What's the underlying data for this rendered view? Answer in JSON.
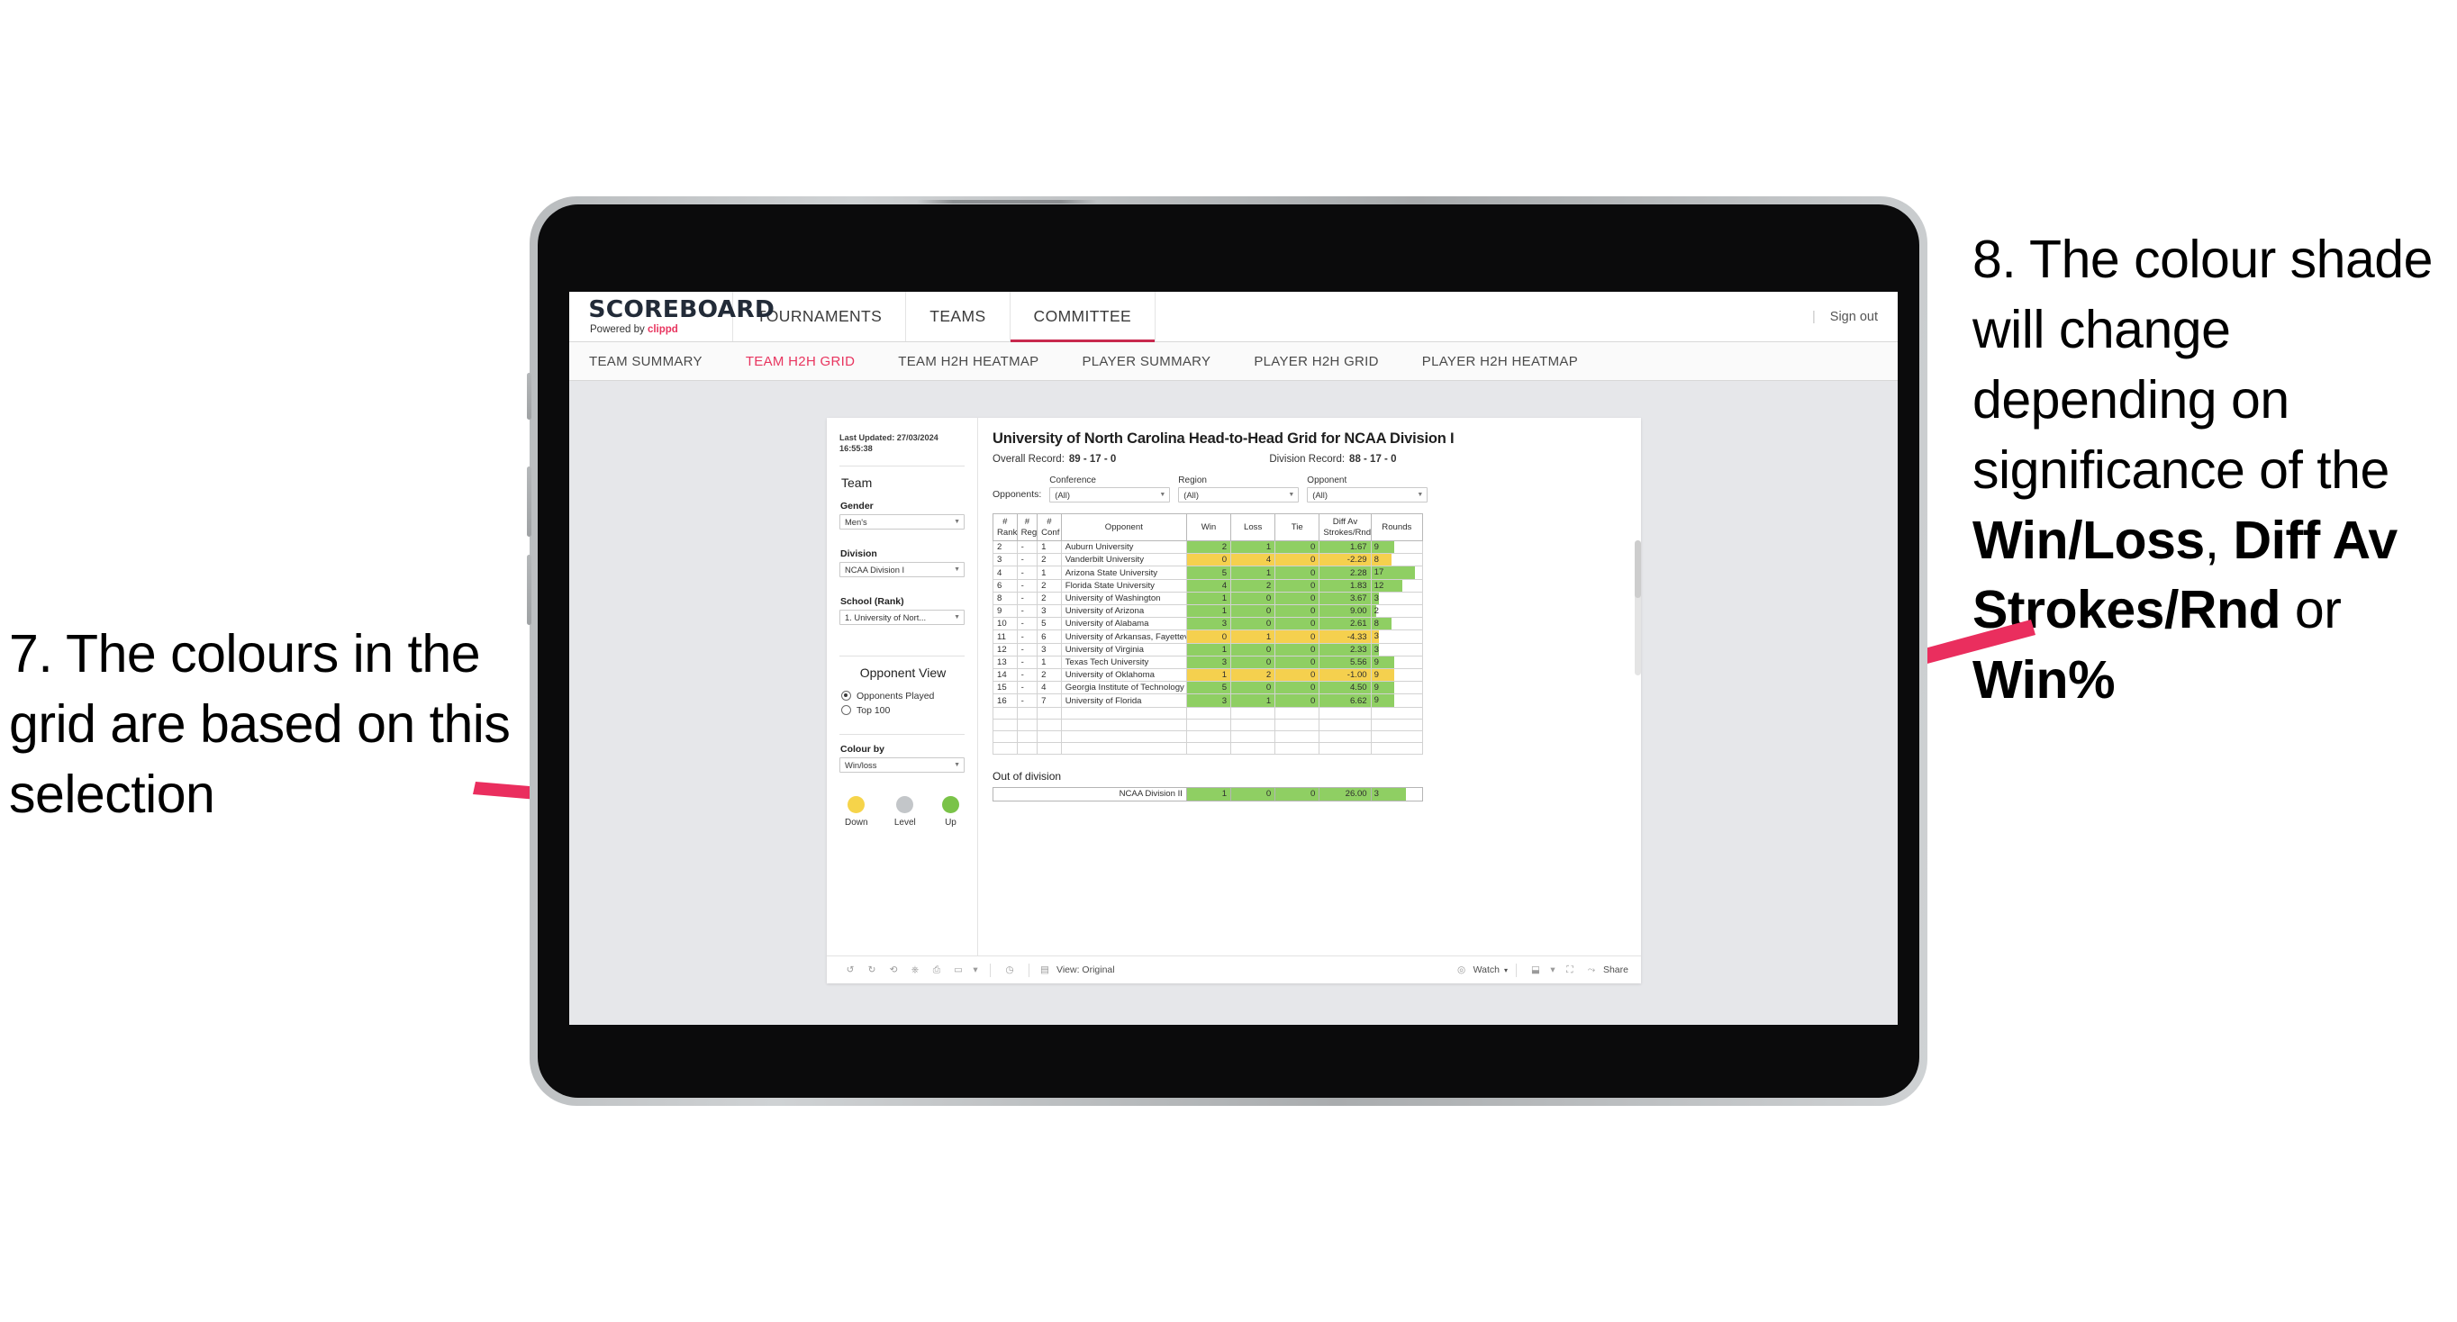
{
  "annotations": {
    "left": {
      "number": "7.",
      "text": "7. The colours in the grid are based on this selection"
    },
    "right": {
      "line1": "8. The colour shade will change depending on significance of the ",
      "bold1": "Win/Loss",
      "mid1": ", ",
      "bold2": "Diff Av Strokes/Rnd",
      "mid2": " or ",
      "bold3": "Win%"
    },
    "arrow_color": "#ea2e5e"
  },
  "app": {
    "brand": {
      "title": "SCOREBOARD",
      "powered_prefix": "Powered by ",
      "powered_brand": "clippd"
    },
    "top_nav": [
      {
        "label": "TOURNAMENTS",
        "active": false
      },
      {
        "label": "TEAMS",
        "active": false
      },
      {
        "label": "COMMITTEE",
        "active": true
      }
    ],
    "sign_out": "Sign out",
    "sign_out_divider": "|",
    "sub_nav": [
      {
        "label": "TEAM SUMMARY",
        "active": false
      },
      {
        "label": "TEAM H2H GRID",
        "active": true
      },
      {
        "label": "TEAM H2H HEATMAP",
        "active": false
      },
      {
        "label": "PLAYER SUMMARY",
        "active": false
      },
      {
        "label": "PLAYER H2H GRID",
        "active": false
      },
      {
        "label": "PLAYER H2H HEATMAP",
        "active": false
      }
    ]
  },
  "sidebar": {
    "last_updated": "Last Updated: 27/03/2024 16:55:38",
    "team_heading": "Team",
    "gender_label": "Gender",
    "gender_value": "Men's",
    "division_label": "Division",
    "division_value": "NCAA Division I",
    "school_label": "School (Rank)",
    "school_value": "1. University of Nort...",
    "opponent_view_heading": "Opponent View",
    "opponent_view_options": [
      {
        "label": "Opponents Played",
        "selected": true
      },
      {
        "label": "Top 100",
        "selected": false
      }
    ],
    "colour_by_label": "Colour by",
    "colour_by_value": "Win/loss",
    "legend": [
      {
        "label": "Down",
        "color": "#f6d44a"
      },
      {
        "label": "Level",
        "color": "#c3c6c9"
      },
      {
        "label": "Up",
        "color": "#7ac348"
      }
    ]
  },
  "viz": {
    "title": "University of North Carolina Head-to-Head Grid for NCAA Division I",
    "overall_record_label": "Overall Record:",
    "overall_record_value": "89 - 17 - 0",
    "division_record_label": "Division Record:",
    "division_record_value": "88 - 17 - 0",
    "opponents_label": "Opponents:",
    "filters": [
      {
        "label": "Conference",
        "value": "(All)"
      },
      {
        "label": "Region",
        "value": "(All)"
      },
      {
        "label": "Opponent",
        "value": "(All)"
      }
    ],
    "columns": [
      "# Rank",
      "# Reg",
      "# Conf",
      "Opponent",
      "Win",
      "Loss",
      "Tie",
      "Diff Av Strokes/Rnd",
      "Rounds"
    ],
    "columns_split": [
      {
        "l1": "#",
        "l2": "Rank"
      },
      {
        "l1": "#",
        "l2": "Reg"
      },
      {
        "l1": "#",
        "l2": "Conf"
      },
      {
        "l1": "Opponent",
        "l2": ""
      },
      {
        "l1": "Win",
        "l2": ""
      },
      {
        "l1": "Loss",
        "l2": ""
      },
      {
        "l1": "Tie",
        "l2": ""
      },
      {
        "l1": "Diff Av",
        "l2": "Strokes/Rnd"
      },
      {
        "l1": "Rounds",
        "l2": ""
      }
    ],
    "rows": [
      {
        "rank": "2",
        "reg": "-",
        "conf": "1",
        "opponent": "Auburn University",
        "win": "2",
        "loss": "1",
        "tie": "0",
        "diff": "1.67",
        "rounds": "9",
        "color": "up"
      },
      {
        "rank": "3",
        "reg": "-",
        "conf": "2",
        "opponent": "Vanderbilt University",
        "win": "0",
        "loss": "4",
        "tie": "0",
        "diff": "-2.29",
        "rounds": "8",
        "color": "down"
      },
      {
        "rank": "4",
        "reg": "-",
        "conf": "1",
        "opponent": "Arizona State University",
        "win": "5",
        "loss": "1",
        "tie": "0",
        "diff": "2.28",
        "rounds": "17",
        "color": "up"
      },
      {
        "rank": "6",
        "reg": "-",
        "conf": "2",
        "opponent": "Florida State University",
        "win": "4",
        "loss": "2",
        "tie": "0",
        "diff": "1.83",
        "rounds": "12",
        "color": "up"
      },
      {
        "rank": "8",
        "reg": "-",
        "conf": "2",
        "opponent": "University of Washington",
        "win": "1",
        "loss": "0",
        "tie": "0",
        "diff": "3.67",
        "rounds": "3",
        "color": "up"
      },
      {
        "rank": "9",
        "reg": "-",
        "conf": "3",
        "opponent": "University of Arizona",
        "win": "1",
        "loss": "0",
        "tie": "0",
        "diff": "9.00",
        "rounds": "2",
        "color": "up"
      },
      {
        "rank": "10",
        "reg": "-",
        "conf": "5",
        "opponent": "University of Alabama",
        "win": "3",
        "loss": "0",
        "tie": "0",
        "diff": "2.61",
        "rounds": "8",
        "color": "up"
      },
      {
        "rank": "11",
        "reg": "-",
        "conf": "6",
        "opponent": "University of Arkansas, Fayetteville",
        "win": "0",
        "loss": "1",
        "tie": "0",
        "diff": "-4.33",
        "rounds": "3",
        "color": "down"
      },
      {
        "rank": "12",
        "reg": "-",
        "conf": "3",
        "opponent": "University of Virginia",
        "win": "1",
        "loss": "0",
        "tie": "0",
        "diff": "2.33",
        "rounds": "3",
        "color": "up"
      },
      {
        "rank": "13",
        "reg": "-",
        "conf": "1",
        "opponent": "Texas Tech University",
        "win": "3",
        "loss": "0",
        "tie": "0",
        "diff": "5.56",
        "rounds": "9",
        "color": "up"
      },
      {
        "rank": "14",
        "reg": "-",
        "conf": "2",
        "opponent": "University of Oklahoma",
        "win": "1",
        "loss": "2",
        "tie": "0",
        "diff": "-1.00",
        "rounds": "9",
        "color": "down"
      },
      {
        "rank": "15",
        "reg": "-",
        "conf": "4",
        "opponent": "Georgia Institute of Technology",
        "win": "5",
        "loss": "0",
        "tie": "0",
        "diff": "4.50",
        "rounds": "9",
        "color": "up"
      },
      {
        "rank": "16",
        "reg": "-",
        "conf": "7",
        "opponent": "University of Florida",
        "win": "3",
        "loss": "1",
        "tie": "0",
        "diff": "6.62",
        "rounds": "9",
        "color": "up"
      }
    ],
    "out_of_division_title": "Out of division",
    "out_of_division_row": {
      "name": "NCAA Division II",
      "win": "1",
      "loss": "0",
      "tie": "0",
      "diff": "26.00",
      "rounds": "3",
      "color": "up"
    },
    "colors": {
      "up": "#8fcf63",
      "down": "#f5d04e",
      "level": "#c3c6c9"
    }
  },
  "toolbar": {
    "icons": [
      "undo-icon",
      "redo-icon",
      "revert-icon",
      "refresh-data-icon",
      "pause-auto-updates-icon",
      "alerts-icon",
      "dropdown-caret-icon",
      "custom-views-icon"
    ],
    "view_label": "View: Original",
    "watch_label": "Watch",
    "share_label": "Share"
  }
}
